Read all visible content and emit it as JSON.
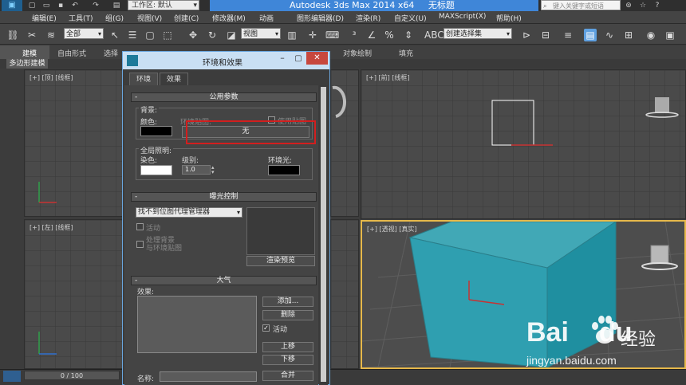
{
  "titlebar": {
    "workspace": "工作区: 默认",
    "app_name": "Autodesk 3ds Max  2014 x64",
    "doc_name": "无标题",
    "search_placeholder": "键入关键字或短语"
  },
  "menubar": [
    "编辑(E)",
    "工具(T)",
    "组(G)",
    "视图(V)",
    "创建(C)",
    "修改器(M)",
    "动画",
    "图形编辑器(D)",
    "渲染(R)",
    "自定义(U)",
    "MAXScript(X)",
    "帮助(H)"
  ],
  "toolbar": {
    "filter_select": "全部",
    "view_select": "视图",
    "selection_set_placeholder": "创建选择集"
  },
  "ribbon": {
    "tabs": [
      "建模",
      "自由形式",
      "选择",
      "对象绘制",
      "填充"
    ],
    "sub_tab": "多边形建模"
  },
  "viewports": {
    "top": "[+] [顶] [线框]",
    "front": "[+] [前] [线框]",
    "left": "[+] [左] [线框]",
    "perspective": "[+] [透视] [真实]"
  },
  "status": {
    "frame": "0 / 100"
  },
  "dialog": {
    "title": "环境和效果",
    "tabs": [
      "环境",
      "效果"
    ],
    "common_params": {
      "header": "公用参数",
      "background_group": "背景:",
      "color_label": "颜色:",
      "env_map_label": "环境贴图:",
      "use_map_label": "使用贴图",
      "map_button": "无",
      "global_lighting_group": "全局照明:",
      "tint_label": "染色:",
      "level_label": "级别:",
      "level_value": "1.0",
      "ambient_label": "环境光:"
    },
    "exposure": {
      "header": "曝光控制",
      "select": "找不到位图代理管理器",
      "active_label": "活动",
      "process_bg_label": "处理背景",
      "process_bg_label2": "与环境贴图",
      "render_preview": "渲染预览"
    },
    "atmosphere": {
      "header": "大气",
      "effects_label": "效果:",
      "add_button": "添加...",
      "delete_button": "删除",
      "active_label": "活动",
      "move_up_button": "上移",
      "move_down_button": "下移",
      "name_label": "名称:",
      "merge_button": "合并"
    },
    "colors": {
      "background_swatch": "#000000",
      "tint_swatch": "#ffffff",
      "ambient_swatch": "#000000"
    }
  },
  "watermark": {
    "brand": "Bai",
    "brand_suffix": "du",
    "cn": "经验",
    "url": "jingyan.baidu.com"
  }
}
